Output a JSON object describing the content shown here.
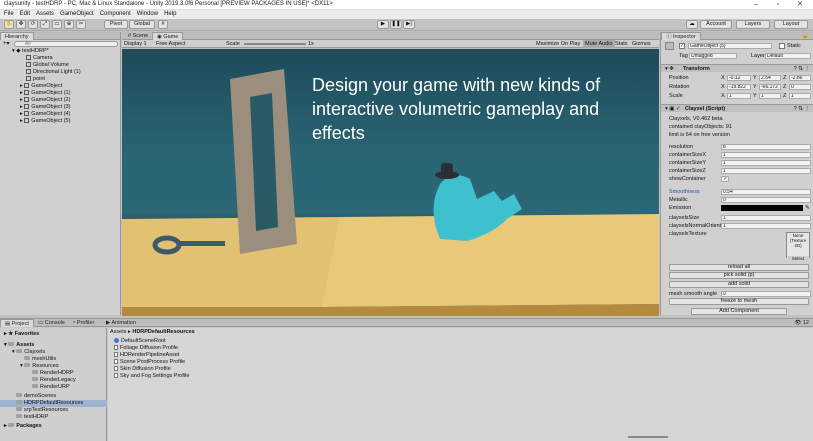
{
  "window": {
    "title": "claysunity - testHDRP - PC, Mac & Linux Standalone - Unity 2019.3.0f6 Personal [PREVIEW PACKAGES IN USE]* <DX11>"
  },
  "menu": [
    "File",
    "Edit",
    "Assets",
    "GameObject",
    "Component",
    "Window",
    "Help"
  ],
  "toolbar": {
    "pivot": "Pivot",
    "global": "Global",
    "account": "Account",
    "layers": "Layers",
    "layout": "Layout"
  },
  "hierarchy": {
    "tab": "Hierarchy",
    "search_placeholder": "All",
    "scene": "testHDRP*",
    "items": [
      "Camera",
      "Global Volume",
      "Directional Light (1)",
      "point",
      "GameObject",
      "GameObject (1)",
      "GameObject (2)",
      "GameObject (3)",
      "GameObject (4)",
      "GameObject (5)"
    ]
  },
  "view": {
    "tab_scene": "Scene",
    "tab_game": "Game",
    "display": "Display 1",
    "aspect": "Free Aspect",
    "scale_label": "Scale",
    "scale_value": "1x",
    "maximize": "Maximize On Play",
    "mute": "Mute Audio",
    "stats": "Stats",
    "gizmos": "Gizmos",
    "caption": "Design your game with new kinds of interactive volumetric gameplay and effects"
  },
  "inspector": {
    "tab": "Inspector",
    "object_name": "GameObject (5)",
    "static_label": "Static",
    "tag_label": "Tag",
    "tag_value": "Untagged",
    "layer_label": "Layer",
    "layer_value": "Default",
    "transform_title": "Transform",
    "position_label": "Position",
    "rotation_label": "Rotation",
    "scale_label": "Scale",
    "position": {
      "x": "-0.12",
      "y": "2.54",
      "z": "-2.86"
    },
    "rotation": {
      "x": "-19.822",
      "y": "-66.172",
      "z": "0"
    },
    "scale": {
      "x": "1",
      "y": "1",
      "z": "1"
    },
    "script_title": "Clayxel (Script)",
    "info1": "Clayxels, V0.462 beta",
    "info2": "contained clayObjects: 91",
    "info3": "limit is 64 on free version",
    "fields": [
      {
        "label": "resolution",
        "value": "8"
      },
      {
        "label": "containerSizeX",
        "value": "1"
      },
      {
        "label": "containerSizeY",
        "value": "1"
      },
      {
        "label": "containerSizeZ",
        "value": "1"
      },
      {
        "label": "showContainer",
        "value": "✓"
      }
    ],
    "smoothness_label": "Smoothness",
    "smoothness_value": "0.54",
    "metallic_label": "Metallic",
    "metallic_value": "0",
    "emission_label": "Emission",
    "clayxels_size_label": "clayxelsSize",
    "clayxels_size_value": "1",
    "normal_label": "clayxelsNormalOrient",
    "normal_value": "1",
    "texture_label": "clayxelsTexture",
    "texture_none": "None",
    "texture_type": "(Texture 2D)",
    "texture_select": "Select",
    "btn_reload": "reload all",
    "btn_pick": "pick solid (p)",
    "btn_add": "add solid",
    "smooth_angle_label": "mesh smooth angle",
    "smooth_angle_value": "0",
    "btn_freeze": "freeze to mesh",
    "btn_add_component": "Add Component"
  },
  "project": {
    "tabs": [
      "Project",
      "Console",
      "Profiler",
      "Animation"
    ],
    "favorites": "Favorites",
    "tree": [
      {
        "label": "Assets",
        "level": 0
      },
      {
        "label": "Clayxels",
        "level": 1
      },
      {
        "label": "meshUtils",
        "level": 2
      },
      {
        "label": "Resources",
        "level": 2
      },
      {
        "label": "RenderHDRP",
        "level": 3
      },
      {
        "label": "RenderLegacy",
        "level": 3
      },
      {
        "label": "RenderURP",
        "level": 3
      },
      {
        "label": "demoScenes",
        "level": 1
      },
      {
        "label": "HDRPDefaultResources",
        "level": 1
      },
      {
        "label": "srpTestResources",
        "level": 1
      },
      {
        "label": "testHDRP",
        "level": 1
      },
      {
        "label": "Packages",
        "level": 0
      }
    ],
    "breadcrumb_root": "Assets",
    "breadcrumb_current": "HDRPDefaultResources",
    "files": [
      "DefaultSceneRoot",
      "Foliage Diffusion Profile",
      "HDRenderPipelineAsset",
      "Scene PostProcess Profile",
      "Skin Diffusion Profile",
      "Sky and Fog Settings Profile"
    ],
    "count": "12"
  }
}
